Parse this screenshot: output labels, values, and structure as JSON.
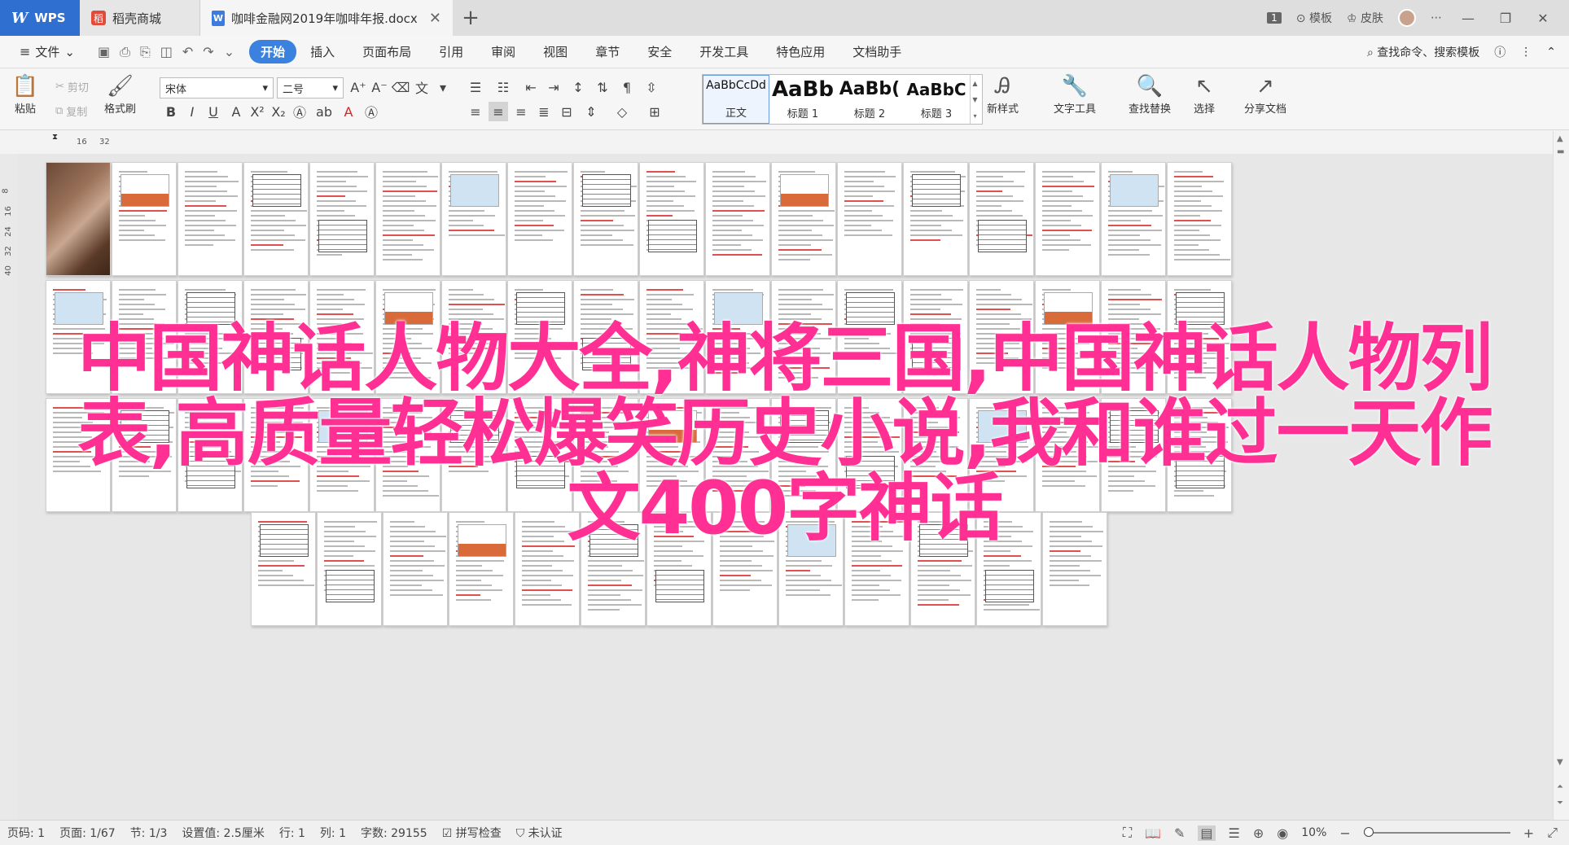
{
  "tabs": {
    "wps": "WPS",
    "store": "稻壳商城",
    "doc": "咖啡金融网2019年咖啡年报.docx",
    "close": "✕",
    "add": "+"
  },
  "titlebar_right": {
    "badge": "1",
    "template": "模板",
    "skin": "皮肤"
  },
  "menu": {
    "file": "文件",
    "items": [
      "开始",
      "插入",
      "页面布局",
      "引用",
      "审阅",
      "视图",
      "章节",
      "安全",
      "开发工具",
      "特色应用",
      "文档助手"
    ],
    "search": "查找命令、搜索模板"
  },
  "ribbon": {
    "paste": "粘贴",
    "cut": "剪切",
    "copy": "复制",
    "format_painter": "格式刷",
    "font_name": "宋体",
    "font_size": "二号",
    "styles": [
      {
        "sample": "AaBbCcDd",
        "label": "正文"
      },
      {
        "sample": "AaBb",
        "label": "标题 1"
      },
      {
        "sample": "AaBb(",
        "label": "标题 2"
      },
      {
        "sample": "AaBbC",
        "label": "标题 3"
      }
    ],
    "new_style": "新样式",
    "text_tools": "文字工具",
    "find_replace": "查找替换",
    "select": "选择",
    "share": "分享文档"
  },
  "ruler": {
    "h_marks": [
      "16",
      "32"
    ],
    "v_marks": [
      "8",
      "16",
      "24",
      "32",
      "40"
    ]
  },
  "overlay": {
    "text": "中国神话人物大全,神将三国,中国神话人物列表,高质量轻松爆笑历史小说,我和谁过一天作文400字神话"
  },
  "status": {
    "page_num": "页码: 1",
    "page": "页面: 1/67",
    "section": "节: 1/3",
    "position": "设置值: 2.5厘米",
    "row": "行: 1",
    "col": "列: 1",
    "words": "字数: 29155",
    "spell": "拼写检查",
    "cert": "未认证",
    "zoom": "10%"
  },
  "colors": {
    "accent": "#3b82e0",
    "overlay": "#ff2f93",
    "wps_tab": "#2f6fd0"
  }
}
